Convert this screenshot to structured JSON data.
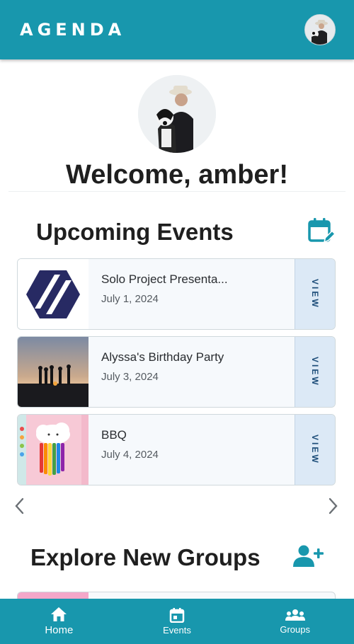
{
  "app": {
    "title": "AGENDA"
  },
  "colors": {
    "primary": "#1897ad",
    "card_bg": "#f6f9fc",
    "view_bg": "#dce9f6",
    "view_text": "#1e4e7a"
  },
  "profile": {
    "welcome": "Welcome, amber!"
  },
  "upcoming": {
    "title": "Upcoming Events",
    "icon": "calendar-edit-icon",
    "events": [
      {
        "title": "Solo Project Presenta...",
        "date": "July 1, 2024",
        "view": "VIEW"
      },
      {
        "title": "Alyssa's Birthday Party",
        "date": "July 3, 2024",
        "view": "VIEW"
      },
      {
        "title": "BBQ",
        "date": "July 4, 2024",
        "view": "VIEW"
      }
    ]
  },
  "groups": {
    "title": "Explore New Groups",
    "icon": "add-person-icon"
  },
  "nav": {
    "items": [
      {
        "label": "Home",
        "icon": "home-icon",
        "active": true
      },
      {
        "label": "Events",
        "icon": "calendar-icon",
        "active": false
      },
      {
        "label": "Groups",
        "icon": "groups-icon",
        "active": false
      }
    ]
  }
}
